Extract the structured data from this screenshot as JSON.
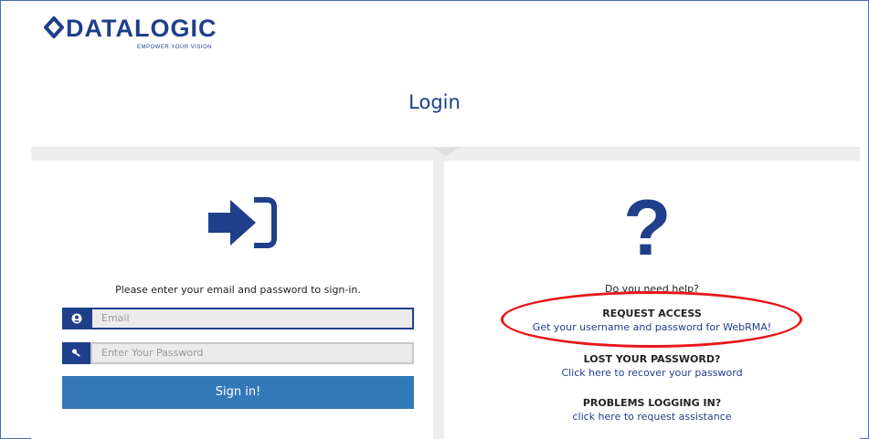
{
  "logo": {
    "wordmark": "DATALOGIC",
    "tagline": "EMPOWER YOUR VISION"
  },
  "page_title": "Login",
  "login": {
    "instruction": "Please enter your email and password to sign-in.",
    "email_placeholder": "Email",
    "password_placeholder": "Enter Your Password",
    "signin_label": "Sign in!"
  },
  "help": {
    "question": "Do you need help?",
    "request_access": {
      "heading": "REQUEST ACCESS",
      "link": "Get your username and password for WebRMA!"
    },
    "lost_password": {
      "heading": "LOST YOUR PASSWORD?",
      "link": "Click here to recover your password"
    },
    "problems": {
      "heading": "PROBLEMS LOGGING IN?",
      "link": "click here to request assistance"
    }
  },
  "colors": {
    "brand": "#1f3f8a",
    "button": "#3378b8",
    "highlight": "#e8161b"
  },
  "icons": {
    "signin": "sign-in-arrow-icon",
    "help": "question-mark-icon",
    "user": "user-icon",
    "key": "key-icon"
  }
}
